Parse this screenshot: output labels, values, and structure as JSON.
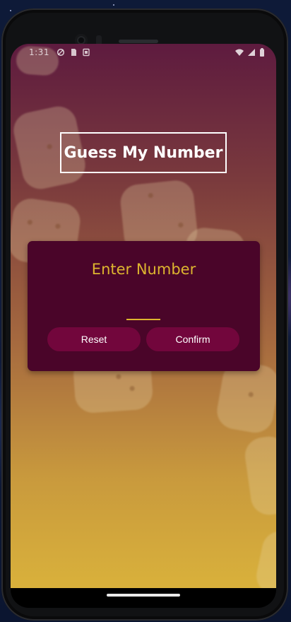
{
  "status_bar": {
    "time": "1:31",
    "left_icons": [
      "data-saver-icon",
      "sim-card-icon",
      "screenshot-icon"
    ],
    "right_icons": [
      "wifi-icon",
      "cell-signal-icon",
      "battery-icon"
    ]
  },
  "app": {
    "title": "Guess My Number",
    "input_card": {
      "heading": "Enter Number",
      "input_value": "",
      "reset_label": "Reset",
      "confirm_label": "Confirm"
    }
  },
  "colors": {
    "accent": "#ddb52f",
    "card": "#4a0529",
    "button": "#72063c",
    "gradient_top": "#5e1b3f",
    "gradient_bottom": "#d9b13b"
  }
}
